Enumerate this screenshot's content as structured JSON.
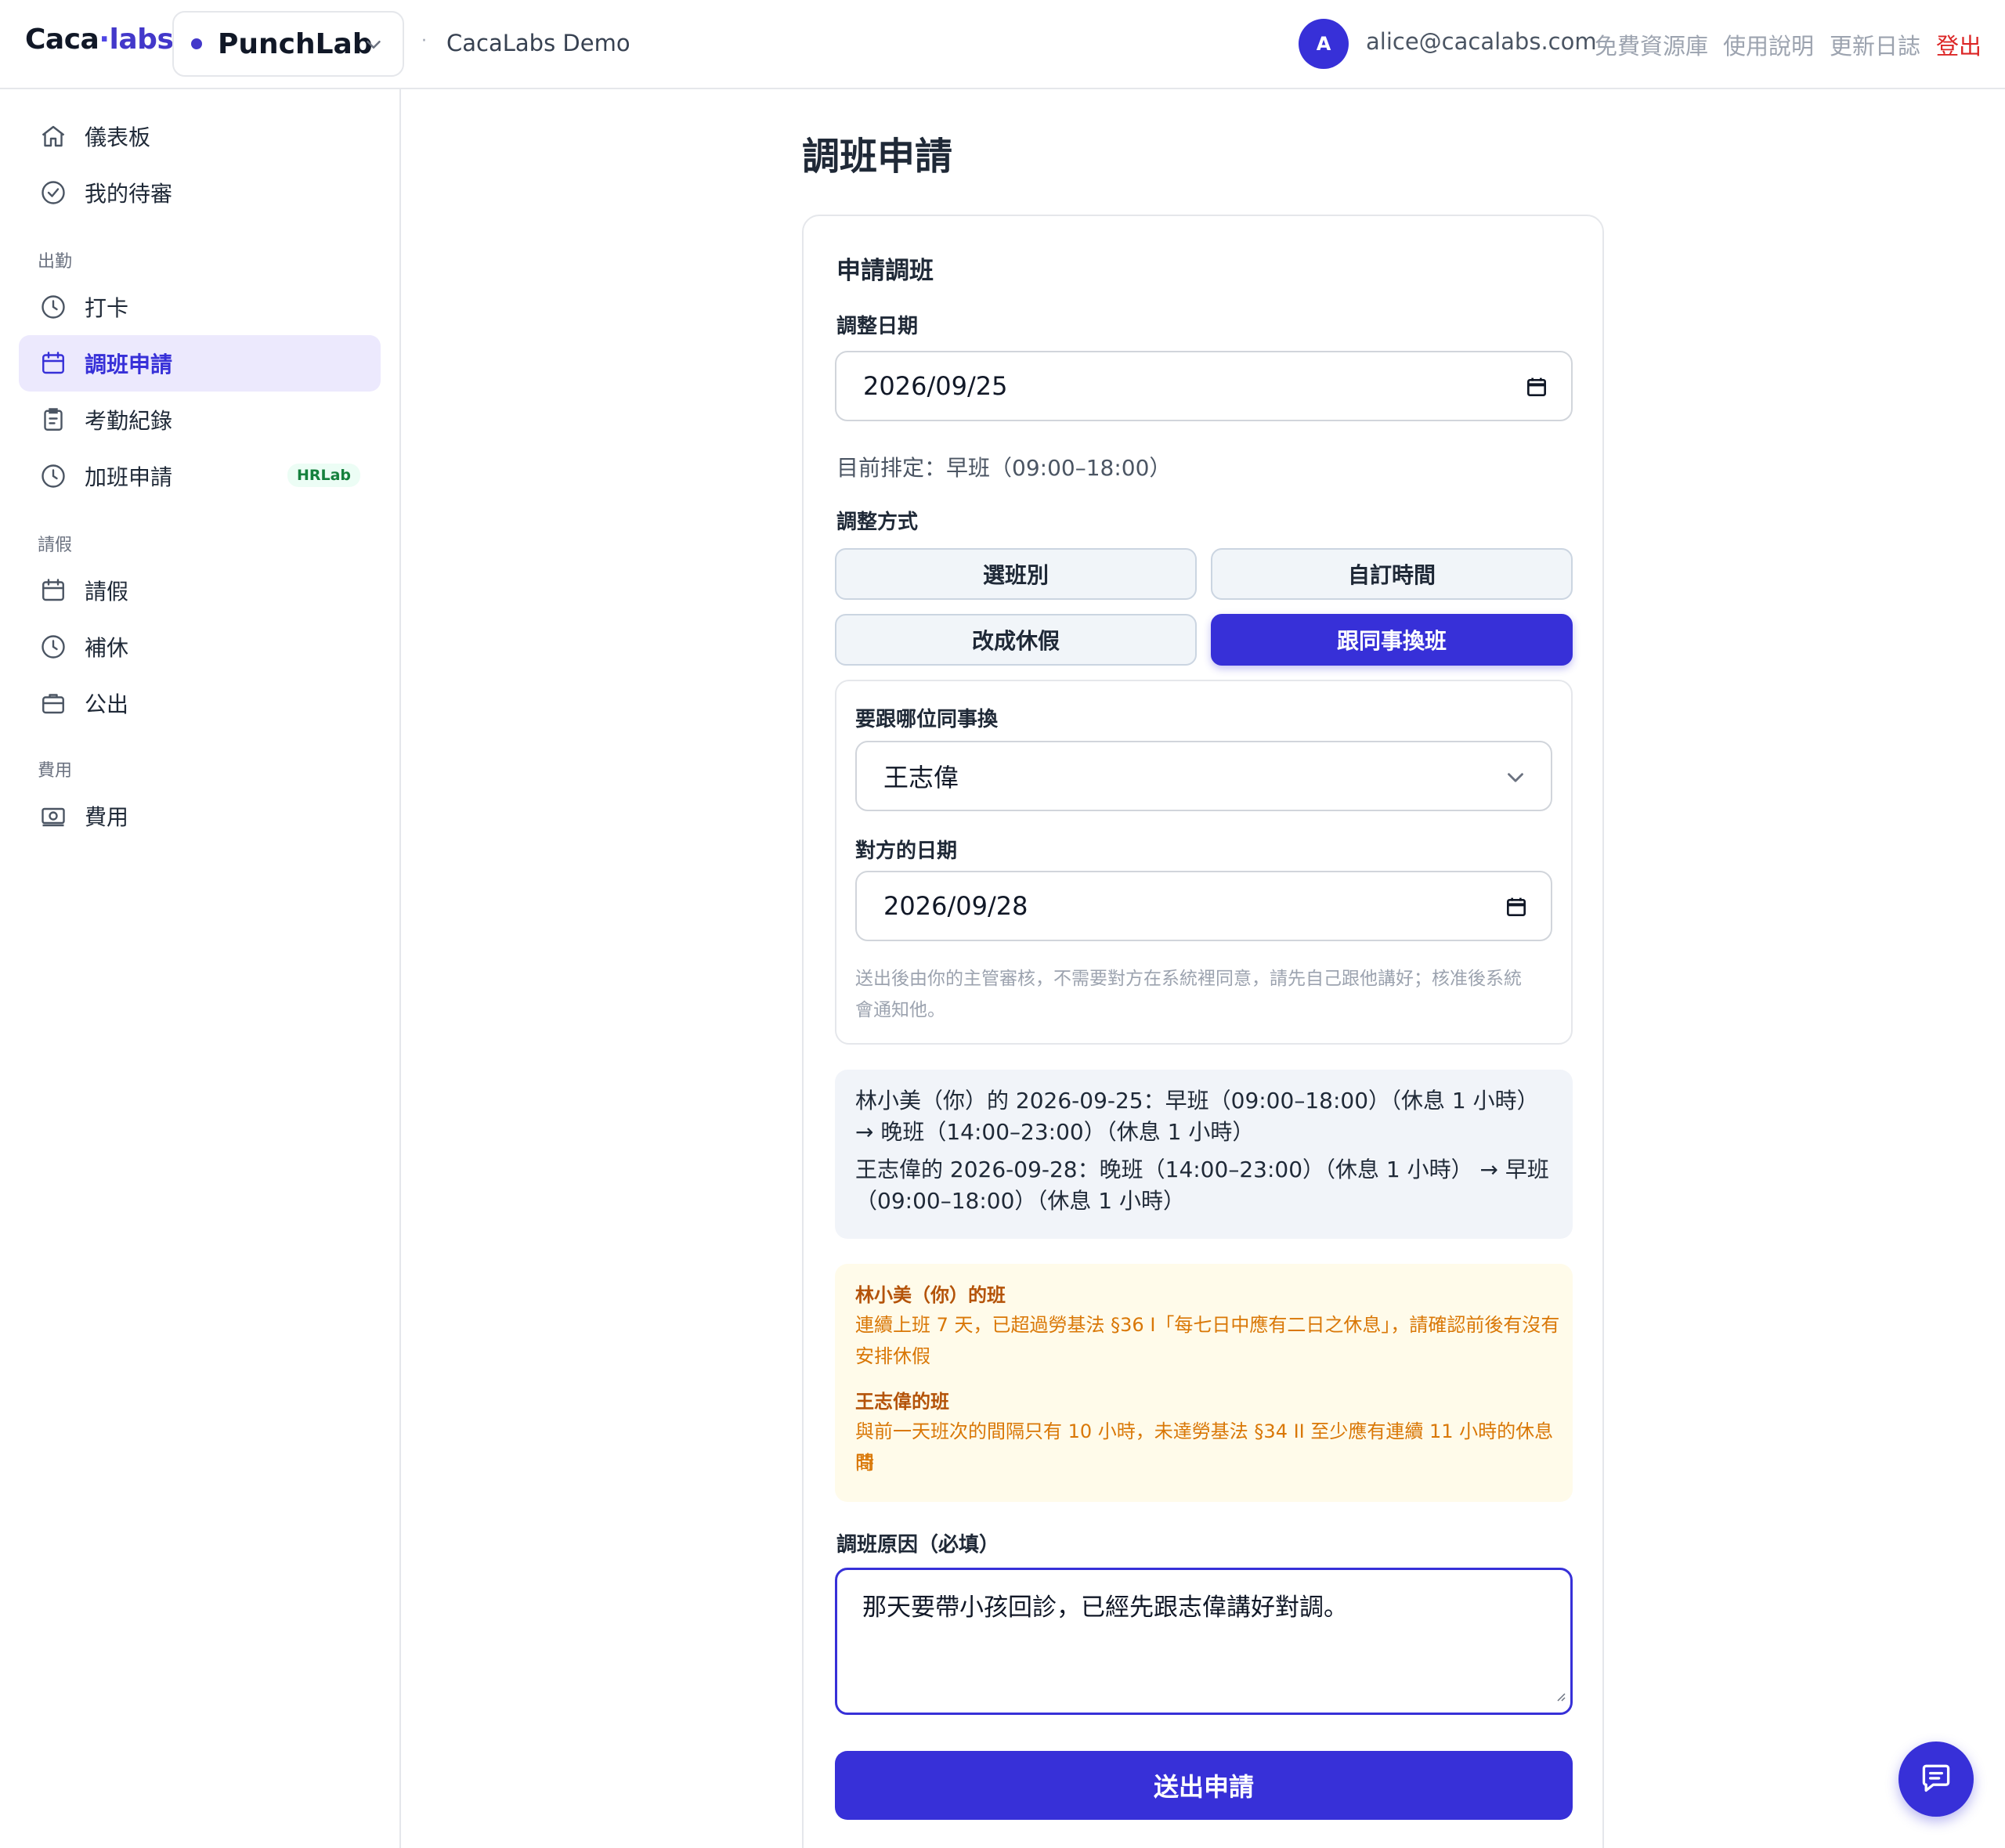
{
  "header": {
    "logo_caca": "Caca",
    "logo_dot": "·",
    "logo_labs": "labs",
    "app_name": "PunchLab",
    "org_separator": "·",
    "org_name": "CacaLabs Demo",
    "avatar_initial": "A",
    "user_email": "alice@cacalabs.com",
    "links": [
      "免費資源庫",
      "使用說明",
      "更新日誌"
    ],
    "logout": "登出"
  },
  "sidebar": {
    "top_items": [
      {
        "label": "儀表板",
        "icon": "home-icon"
      },
      {
        "label": "我的待審",
        "icon": "check-circle-icon"
      }
    ],
    "sections": [
      {
        "title": "出勤",
        "items": [
          {
            "label": "打卡",
            "icon": "clock-icon"
          },
          {
            "label": "調班申請",
            "icon": "calendar-icon",
            "active": true
          },
          {
            "label": "考勤紀錄",
            "icon": "clipboard-icon"
          },
          {
            "label": "加班申請",
            "icon": "clock-icon",
            "badge": "HRLab"
          }
        ]
      },
      {
        "title": "請假",
        "items": [
          {
            "label": "請假",
            "icon": "calendar-icon"
          },
          {
            "label": "補休",
            "icon": "clock-icon"
          },
          {
            "label": "公出",
            "icon": "briefcase-icon"
          }
        ]
      },
      {
        "title": "費用",
        "items": [
          {
            "label": "費用",
            "icon": "money-icon"
          }
        ]
      }
    ]
  },
  "main": {
    "page_title": "調班申請",
    "card_title": "申請調班",
    "adjust_date_label": "調整日期",
    "adjust_date_value": "2026/09/25",
    "current_schedule": "目前排定：早班（09:00–18:00）",
    "mode_label": "調整方式",
    "modes": [
      "選班別",
      "自訂時間",
      "改成休假",
      "跟同事換班"
    ],
    "active_mode": "跟同事換班",
    "swap": {
      "colleague_label": "要跟哪位同事換",
      "colleague_value": "王志偉",
      "their_date_label": "對方的日期",
      "their_date_value": "2026/09/28",
      "note_line1": "送出後由你的主管審核，不需要對方在系統裡同意，請先自己跟他講好；核准後系統",
      "note_line2": "會通知他。"
    },
    "summary": {
      "line1a": "林小美（你）的 2026-09-25：早班（09:00–18:00）（休息 1 小時）",
      "line1b": "→ 晚班（14:00–23:00）（休息 1 小時）",
      "line2a": "王志偉的 2026-09-28：晚班（14:00–23:00）（休息 1 小時） → 早班",
      "line2b": "（09:00–18:00）（休息 1 小時）"
    },
    "warnings": [
      {
        "title": "林小美（你）的班",
        "line1": "連續上班 7 天，已超過勞基法 §36 I「每七日中應有二日之休息」，請確認前後有沒有",
        "line2": "安排休假"
      },
      {
        "title": "王志偉的班",
        "line1": "與前一天班次的間隔只有 10 小時，未達勞基法 §34 II 至少應有連續 11 小時的休息時",
        "line2": "間"
      }
    ],
    "reason_label": "調班原因（必填）",
    "reason_value": "那天要帶小孩回診，已經先跟志偉講好對調。",
    "submit_label": "送出申請"
  },
  "colors": {
    "accent": "#3730d8",
    "active_nav_bg": "#ece9fd",
    "warning_text": "#d97706",
    "warning_bg": "#fffbea",
    "logout": "#dc2626",
    "badge_green": "#15803d"
  }
}
